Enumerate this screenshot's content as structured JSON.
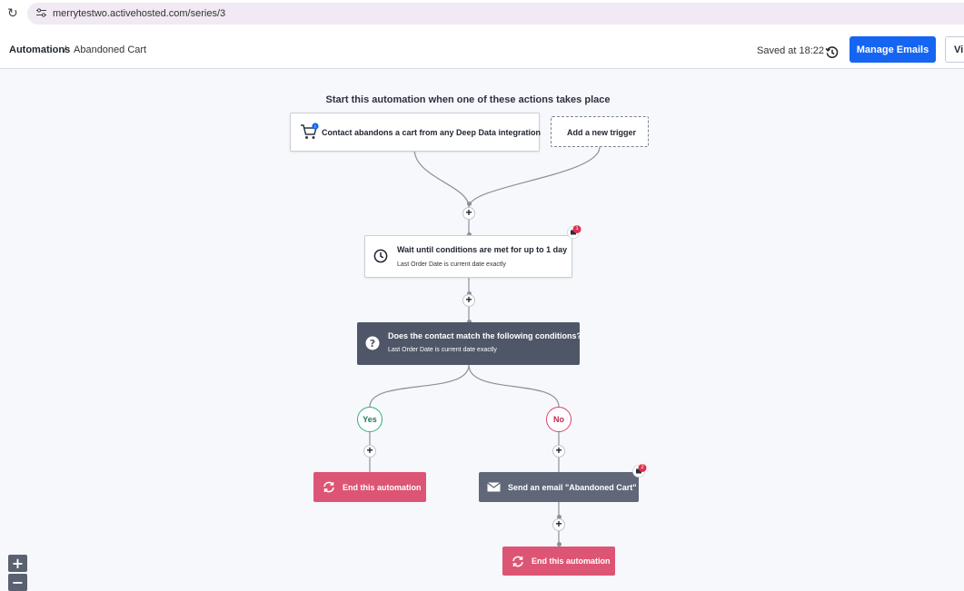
{
  "browser": {
    "url": "merrytestwo.activehosted.com/series/3"
  },
  "header": {
    "breadcrumb_root": "Automations",
    "breadcrumb_sep": "/",
    "breadcrumb_current": "Abandoned Cart",
    "saved_text": "Saved at 18:22",
    "manage_emails_label": "Manage Emails",
    "cut_button_label": "Vi"
  },
  "flow": {
    "heading": "Start this automation when one of these actions takes place",
    "trigger": {
      "label": "Contact abandons a cart from any Deep Data integration"
    },
    "add_trigger_label": "Add a new trigger",
    "wait": {
      "title": "Wait until conditions are met for up to 1 day",
      "subtitle": "Last Order Date is current date exactly",
      "badge_count": "1"
    },
    "condition": {
      "title": "Does the contact match the following conditions?",
      "subtitle": "Last Order Date is current date exactly"
    },
    "yes_label": "Yes",
    "no_label": "No",
    "end_label": "End this automation",
    "email": {
      "label": "Send an email \"Abandoned Cart\"",
      "badge_count": "2"
    }
  },
  "zoom": {
    "in_label": "+",
    "out_label": "−"
  },
  "colors": {
    "primary": "#1565f2",
    "condition": "#4f5668",
    "end": "#dd5574",
    "email": "#5f6779",
    "yes": "#2fae7d",
    "no": "#e0426a"
  }
}
